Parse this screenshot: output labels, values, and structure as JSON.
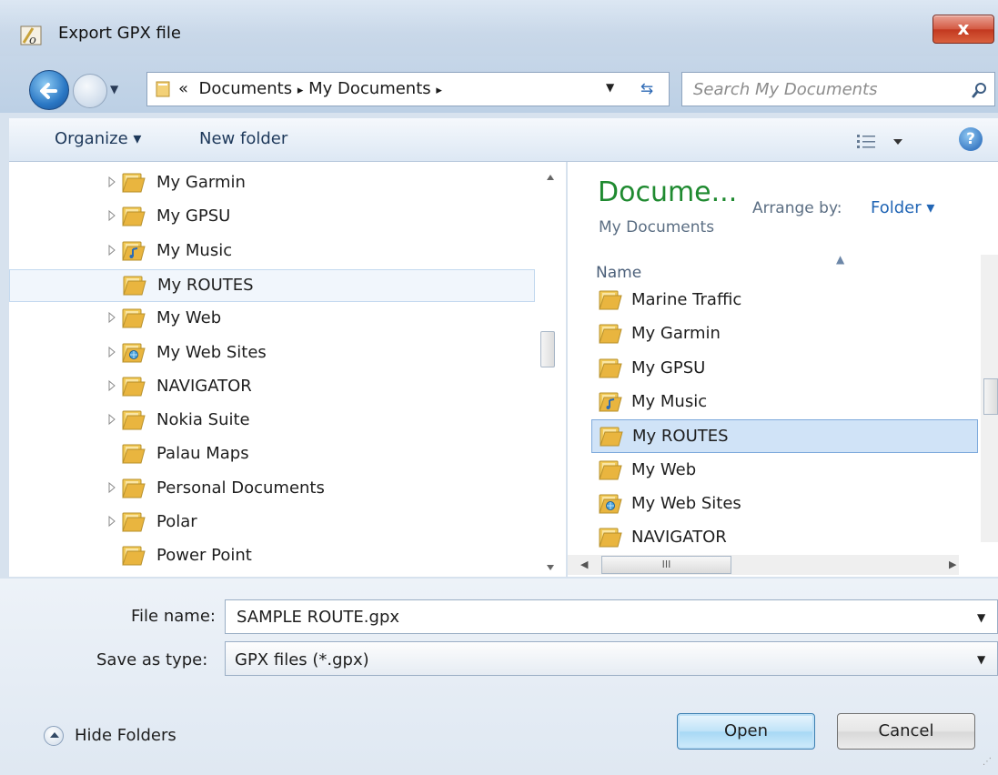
{
  "window": {
    "title": "Export GPX file",
    "close_label": "x"
  },
  "nav": {
    "address_prefix": "«",
    "breadcrumb": [
      "Documents",
      "My Documents"
    ],
    "separator": "▸",
    "search_placeholder": "Search My Documents"
  },
  "toolbar": {
    "organize": "Organize ▾",
    "new_folder": "New folder",
    "help": "?"
  },
  "folder_tree": [
    {
      "label": "My Garmin",
      "expandable": true,
      "icon": "folder-icon"
    },
    {
      "label": "My GPSU",
      "expandable": true,
      "icon": "folder-icon"
    },
    {
      "label": "My Music",
      "expandable": true,
      "icon": "music-folder-icon"
    },
    {
      "label": "My ROUTES",
      "expandable": false,
      "icon": "folder-icon",
      "selected": true
    },
    {
      "label": "My Web",
      "expandable": true,
      "icon": "folder-icon"
    },
    {
      "label": "My Web Sites",
      "expandable": true,
      "icon": "web-folder-icon"
    },
    {
      "label": "NAVIGATOR",
      "expandable": true,
      "icon": "folder-icon"
    },
    {
      "label": "Nokia Suite",
      "expandable": true,
      "icon": "folder-icon"
    },
    {
      "label": "Palau Maps",
      "expandable": false,
      "icon": "folder-icon"
    },
    {
      "label": "Personal Documents",
      "expandable": true,
      "icon": "folder-icon"
    },
    {
      "label": "Polar",
      "expandable": true,
      "icon": "folder-icon"
    },
    {
      "label": "Power Point",
      "expandable": false,
      "icon": "folder-icon"
    }
  ],
  "library": {
    "title": "Docume...",
    "subtitle": "My Documents",
    "arrange_label": "Arrange by:",
    "arrange_value": "Folder ▾",
    "column_name": "Name"
  },
  "files": [
    {
      "label": "Marine Traffic",
      "icon": "folder-icon"
    },
    {
      "label": "My Garmin",
      "icon": "folder-icon"
    },
    {
      "label": "My GPSU",
      "icon": "folder-icon"
    },
    {
      "label": "My Music",
      "icon": "music-folder-icon"
    },
    {
      "label": "My ROUTES",
      "icon": "folder-icon",
      "selected": true
    },
    {
      "label": "My Web",
      "icon": "folder-icon"
    },
    {
      "label": "My Web Sites",
      "icon": "web-folder-icon"
    },
    {
      "label": "NAVIGATOR",
      "icon": "folder-icon"
    }
  ],
  "scroll_thumb_label": "III",
  "form": {
    "filename_label": "File name:",
    "filename_value": "SAMPLE ROUTE.gpx",
    "savetype_label": "Save as type:",
    "savetype_value": "GPX files (*.gpx)"
  },
  "footer": {
    "hide_folders": "Hide Folders",
    "open": "Open",
    "cancel": "Cancel"
  },
  "colors": {
    "accent_green": "#1f8a30",
    "link_blue": "#2266b5",
    "folder_yellow": "#f0c24b"
  }
}
